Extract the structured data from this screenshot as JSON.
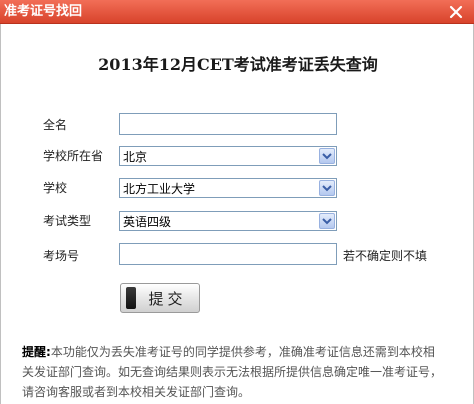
{
  "window": {
    "title": "准考证号找回"
  },
  "heading": "2013年12月CET考试准考证丢失查询",
  "form": {
    "name_label": "全名",
    "name_value": "",
    "province_label": "学校所在省",
    "province_value": "北京",
    "school_label": "学校",
    "school_value": "北方工业大学",
    "exam_type_label": "考试类型",
    "exam_type_value": "英语四级",
    "room_label": "考场号",
    "room_value": "",
    "room_hint": "若不确定则不填",
    "submit_label": "提交"
  },
  "notice": {
    "label": "提醒:",
    "text": "本功能仅为丢失准考证号的同学提供参考，准确准考证信息还需到本校相关发证部门查询。如无查询结果则表示无法根据所提供信息确定唯一准考证号，请咨询客服或者到本校相关发证部门查询。"
  },
  "icons": {
    "close": "close-x-icon",
    "dropdown": "chevron-down-icon"
  },
  "colors": {
    "titlebar": "#e0533b",
    "input_border": "#7f9db9",
    "arrow_button": "#b4c8ef"
  }
}
